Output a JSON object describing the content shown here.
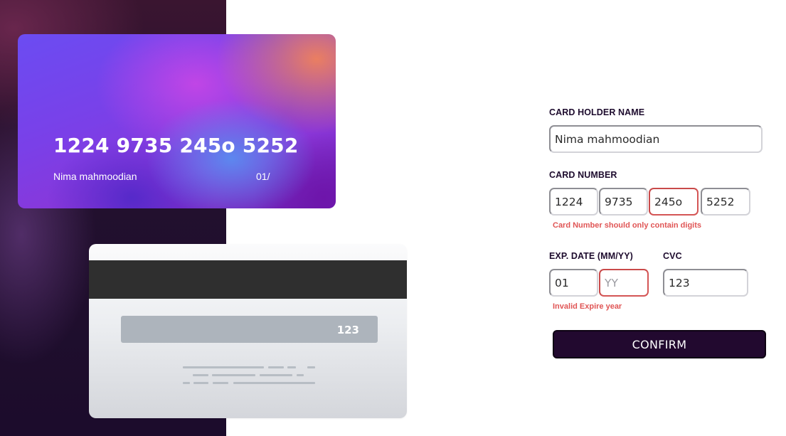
{
  "card_front": {
    "number": "1224 9735 245o 5252",
    "holder_name": "Nima mahmoodian",
    "expiry": "01/"
  },
  "card_back": {
    "cvc": "123"
  },
  "form": {
    "holder_label": "CARD HOLDER NAME",
    "holder_value": "Nima mahmoodian",
    "number_label": "CARD NUMBER",
    "number_parts": [
      "1224",
      "9735",
      "245o",
      "5252"
    ],
    "number_error": "Card Number should only contain digits",
    "exp_label": "EXP. DATE (MM/YY)",
    "exp_month": "01",
    "exp_year_placeholder": "YY",
    "exp_error": "Invalid Expire year",
    "cvc_label": "CVC",
    "cvc_value": "123",
    "confirm_label": "CONFIRM"
  },
  "colors": {
    "left_panel": "#22102e",
    "error": "#e05555",
    "button": "#22092f"
  }
}
